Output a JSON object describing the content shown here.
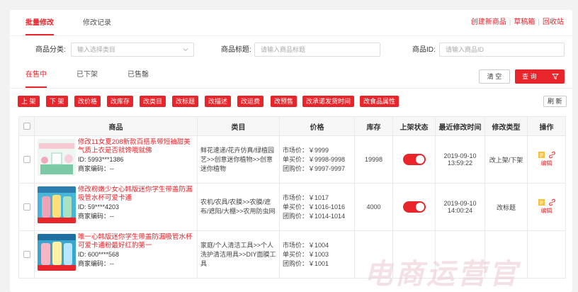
{
  "top_tabs": [
    "批量修改",
    "修改记录"
  ],
  "top_links": [
    "创建新商品",
    "草稿箱",
    "回收站"
  ],
  "filters": {
    "category_label": "商品分类:",
    "category_placeholder": "输入选择类目",
    "title_label": "商品标题:",
    "title_placeholder": "请输入商品标题",
    "id_label": "商品ID:",
    "id_placeholder": "请输入商品ID"
  },
  "status_tabs": [
    "在售中",
    "已下架",
    "已售罄"
  ],
  "buttons": {
    "clear": "清 空",
    "query": "查 询",
    "refresh": "刷 新"
  },
  "actions": [
    "上 架",
    "下 架",
    "改价格",
    "改库存",
    "改类目",
    "改标题",
    "改描述",
    "改运费",
    "改预售",
    "改承诺发货时间",
    "改食品属性"
  ],
  "columns": [
    "商品",
    "类目",
    "价格",
    "库存",
    "上架状态",
    "最近修改时间",
    "修改类型",
    "操作"
  ],
  "rows": [
    {
      "title": "修改11女夏208新款百搭系带短袖甜美气质上衣是否就馋哦就佛",
      "id": "ID: 5993***1386",
      "code": "商家编码：--",
      "category": "鲜花速递/花卉仿真/绿植园艺>>创意迷你植物>>创意迷你植物",
      "market": "市场价：￥9999",
      "single": "单买价：￥9998-9998",
      "group": "团购价：￥9997-9997",
      "stock": "19998",
      "date": "2019-09-10",
      "time": "13:59:22",
      "type": "改上架/下架",
      "edit": "编辑"
    },
    {
      "title": "修改粉嫩少女心韩版迷你学生带盖防漏吸管水杯可爱卡通",
      "id": "ID: 59****4203",
      "code": "商家编码：--",
      "category": "农机/农具/农膜>>农膜/遮布/遮阳/大棚>>农用防虫网",
      "market": "市场价：￥1017",
      "single": "单买价：￥1016-1016",
      "group": "团购价：￥1014-1014",
      "stock": "4000",
      "date": "2019-09-10",
      "time": "14:00:24",
      "type": "改标题",
      "edit": "编辑"
    },
    {
      "title": "唯一心韩版迷你学生带盖防漏吸管水杯可爱卡通粉最好红豹第一",
      "id": "ID: 600****568",
      "code": "商家编码：--",
      "category": "家庭/个人清洁工具>>个人洗护清洁用具>>DIY面膜工具",
      "market": "市场价：￥1004",
      "single": "单买价：￥1003",
      "group": "团购价：￥1001",
      "stock": "",
      "date": "",
      "time": "",
      "type": "",
      "edit": ""
    }
  ],
  "watermark": "电商运营官",
  "colors": {
    "accent": "#e8252b"
  }
}
